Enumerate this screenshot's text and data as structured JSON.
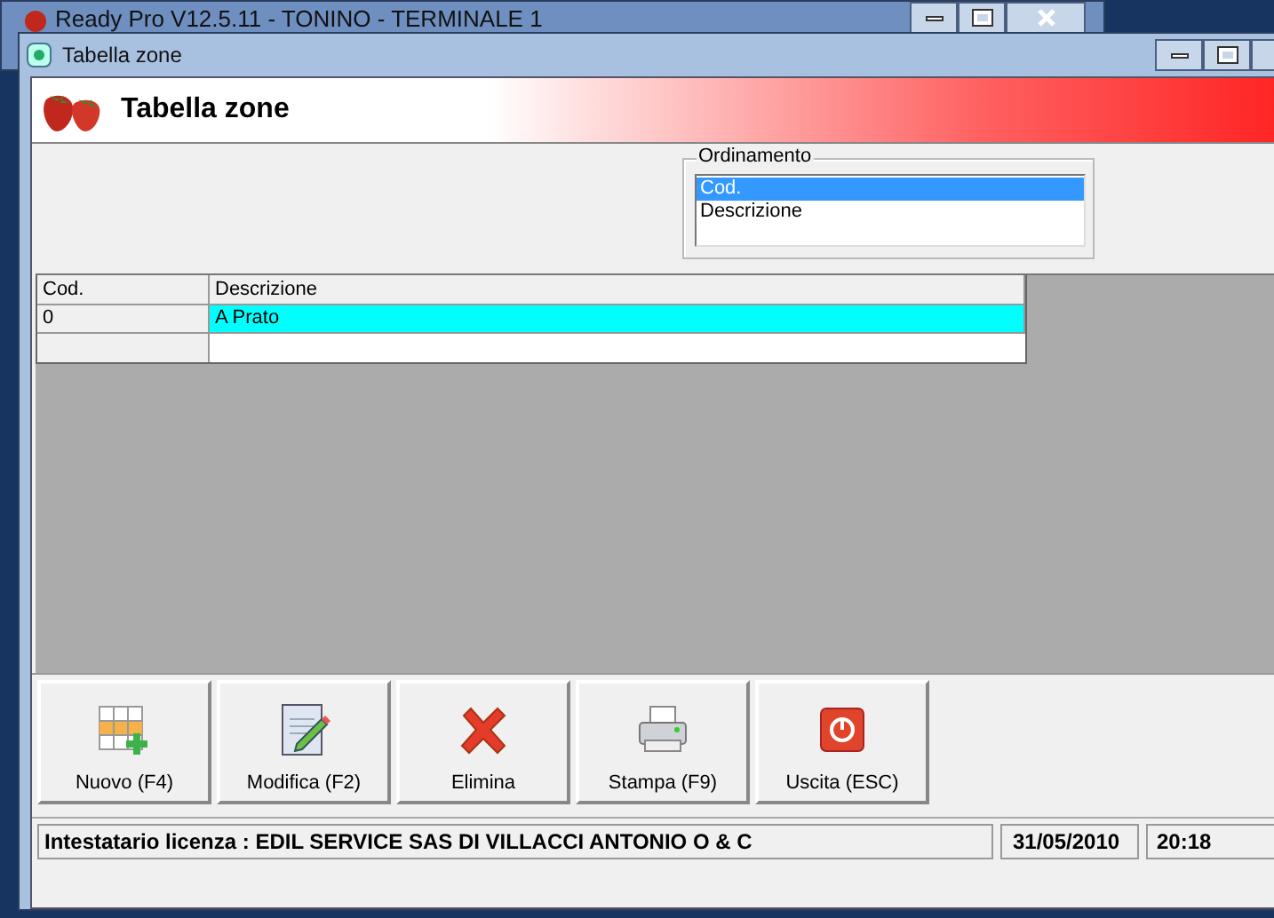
{
  "background_window": {
    "title": "Ready Pro V12.5.11 - TONINO - TERMINALE 1"
  },
  "window": {
    "title": "Tabella zone"
  },
  "header": {
    "title": "Tabella zone"
  },
  "ordering": {
    "label": "Ordinamento",
    "options": [
      {
        "label": "Cod.",
        "selected": true
      },
      {
        "label": "Descrizione",
        "selected": false
      }
    ]
  },
  "table": {
    "columns": [
      "Cod.",
      "Descrizione"
    ],
    "rows": [
      {
        "cells": [
          "0",
          "A Prato"
        ],
        "selected": true
      }
    ]
  },
  "toolbar": [
    {
      "kind": "new",
      "label": "Nuovo (F4)"
    },
    {
      "kind": "edit",
      "label": "Modifica (F2)"
    },
    {
      "kind": "delete",
      "label": "Elimina"
    },
    {
      "kind": "print",
      "label": "Stampa (F9)"
    },
    {
      "kind": "exit",
      "label": "Uscita (ESC)"
    }
  ],
  "status_bar": {
    "license": "Intestatario licenza : EDIL SERVICE SAS DI VILLACCI ANTONIO O & C",
    "date": "31/05/2010",
    "time": "20:18"
  }
}
